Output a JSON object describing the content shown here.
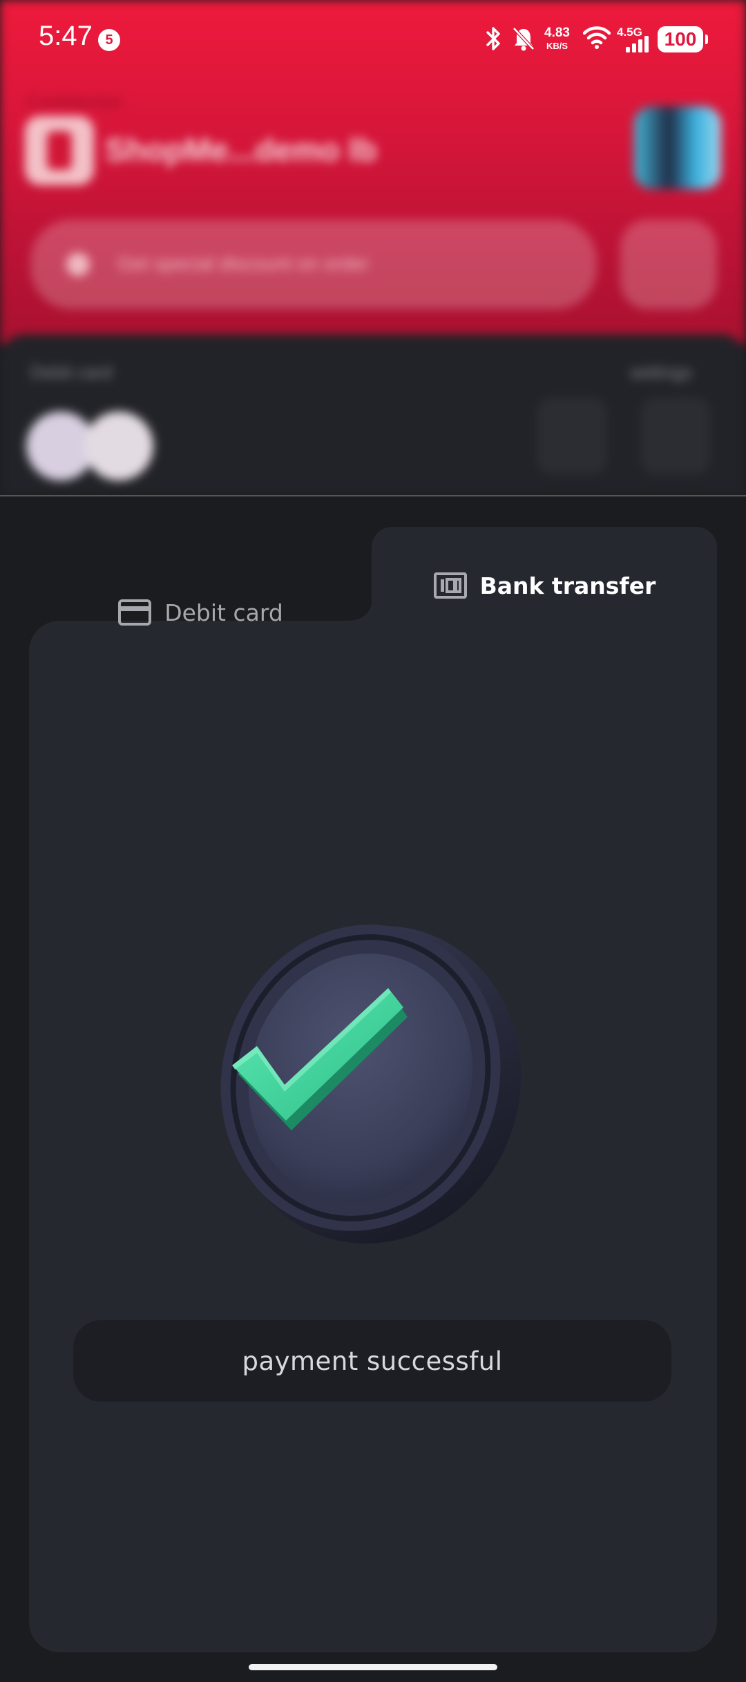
{
  "status_bar": {
    "time": "5:47",
    "notification_count": "5",
    "network_speed_value": "4.83",
    "network_speed_unit": "KB/S",
    "network_type": "4.5G",
    "battery": "100"
  },
  "background_app": {
    "tag_text": "Confidential",
    "title_text": "ShopMe...demo lb",
    "search_placeholder": "Get special discount on order",
    "panel_left_label": "Debit card",
    "panel_right_label": "settings"
  },
  "payment_tabs": {
    "debit_label": "Debit card",
    "bank_label": "Bank transfer",
    "active": "bank"
  },
  "status_message": "payment successful",
  "colors": {
    "brand_red": "#ee1a3c",
    "sheet_bg": "#1b1c20",
    "card_bg": "#262830",
    "success_green": "#3fd49a"
  }
}
